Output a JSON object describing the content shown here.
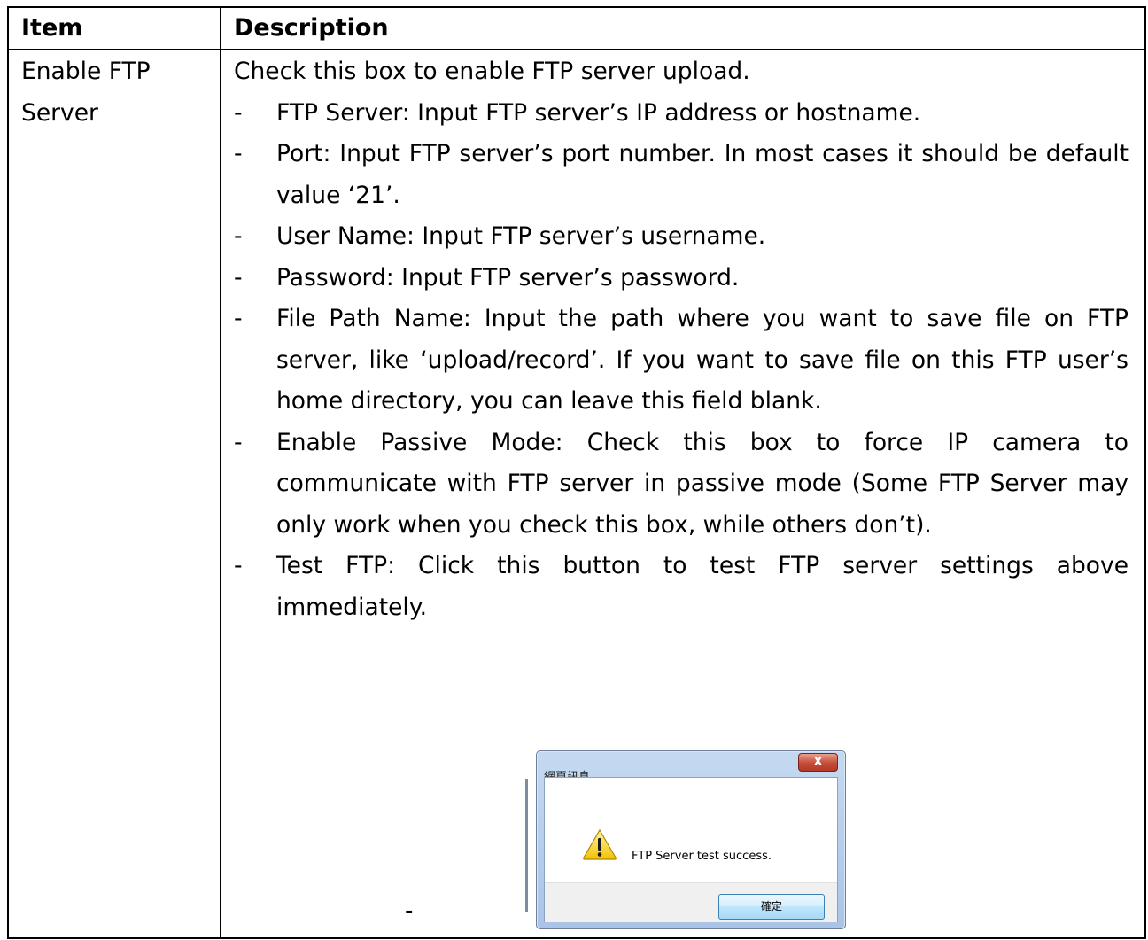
{
  "table": {
    "headers": [
      "Item",
      "Description"
    ],
    "item_lines": "Enable FTP\nServer",
    "intro": "Check this box to enable FTP server upload.",
    "bullets": [
      "FTP Server: Input FTP server’s IP address or hostname.",
      "Port: Input FTP server’s port number. In most cases it should be default value ‘21’.",
      "User Name: Input FTP server’s username.",
      "Password: Input FTP server’s password.",
      "File Path Name: Input the path where you want to save file on FTP server, like ‘upload/record’. If you want to save file on this FTP user’s home directory, you can leave this field blank.",
      "Enable Passive Mode: Check this box to force IP camera to communicate with FTP server in passive mode (Some FTP Server may only work when you check this box, while others don’t).",
      "Test FTP: Click this button to test FTP server settings above immediately."
    ],
    "bullet_marker": "-",
    "trailing_marker": "-"
  },
  "dialog": {
    "title": "網頁訊息",
    "close_glyph": "X",
    "message": "FTP Server test success.",
    "ok_label": "確定",
    "warning_icon": "warning-icon"
  }
}
